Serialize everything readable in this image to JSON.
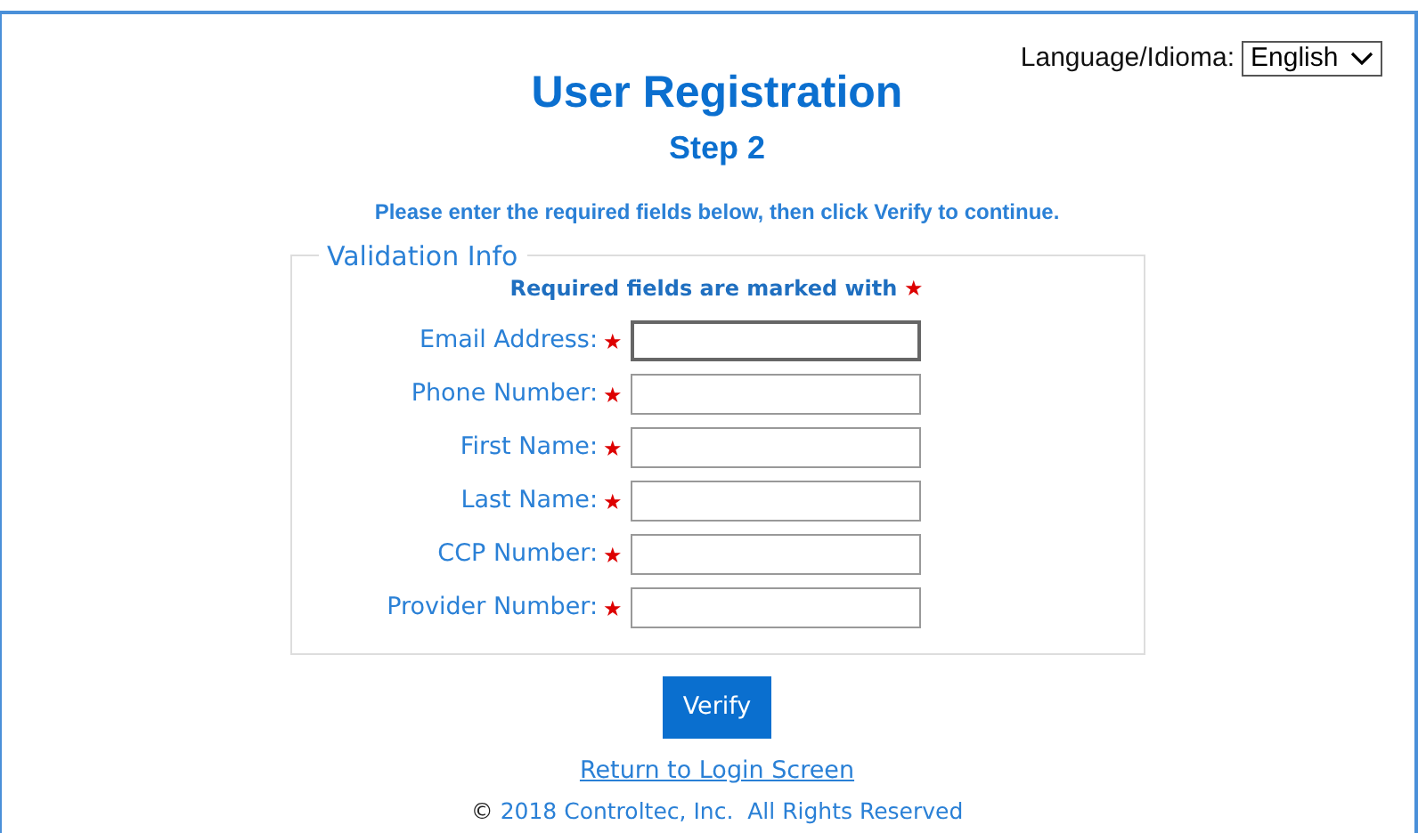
{
  "language": {
    "label": "Language/Idioma:",
    "value": "English"
  },
  "title": "User Registration",
  "subtitle": "Step 2",
  "instructions": "Please enter the required fields below, then click Verify to continue.",
  "fieldset": {
    "legend": "Validation Info",
    "required_note": "Required fields are marked with",
    "required_mark": "★",
    "fields": [
      {
        "label": "Email Address:",
        "mark": "★",
        "focused": true
      },
      {
        "label": "Phone Number:",
        "mark": "★",
        "focused": false
      },
      {
        "label": "First Name:",
        "mark": "★",
        "focused": false
      },
      {
        "label": "Last Name:",
        "mark": "★",
        "focused": false
      },
      {
        "label": "CCP Number:",
        "mark": "★",
        "focused": false
      },
      {
        "label": "Provider Number:",
        "mark": "★",
        "focused": false
      }
    ]
  },
  "verify_button": "Verify",
  "return_link": "Return to Login Screen",
  "footer": {
    "symbol": "©",
    "text": "2018 Controltec, Inc.  All Rights Reserved"
  }
}
